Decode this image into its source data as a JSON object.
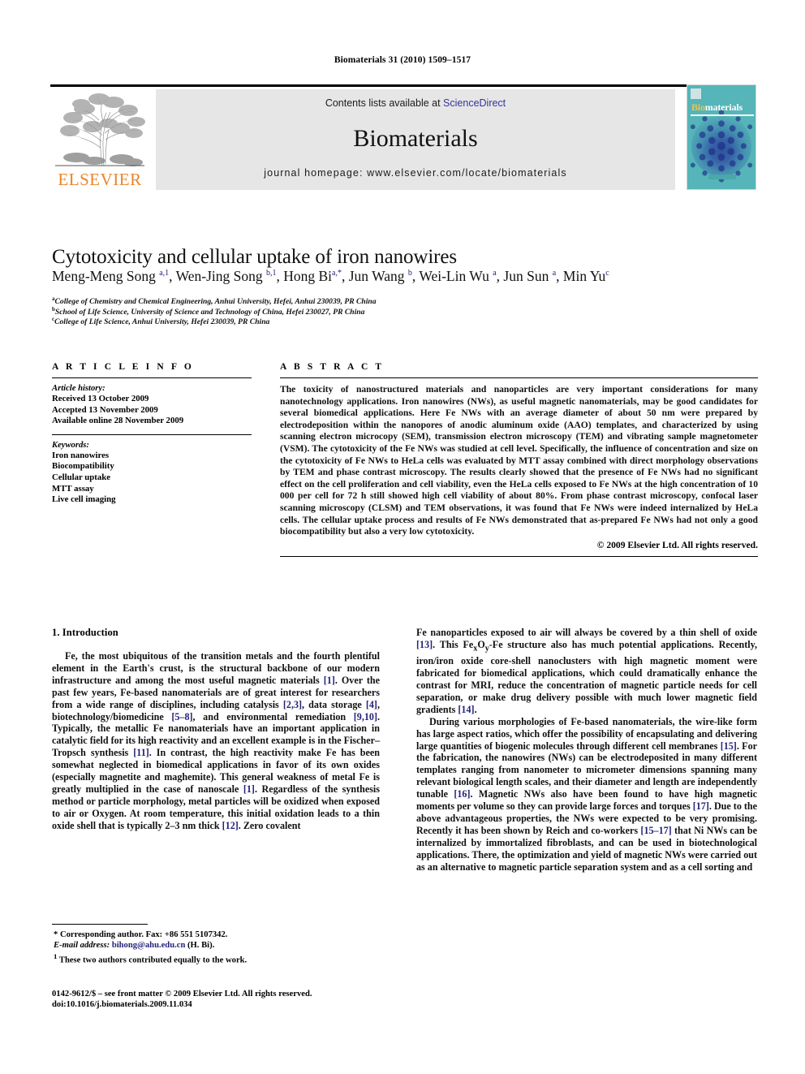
{
  "running_head": "Biomaterials 31 (2010) 1509–1517",
  "masthead": {
    "contents_prefix": "Contents lists available at ",
    "sciencedirect": "ScienceDirect",
    "journal_name": "Biomaterials",
    "homepage": "journal homepage: www.elsevier.com/locate/biomaterials",
    "publisher_wordmark": "ELSEVIER",
    "publisher_logo_icon": "elsevier-tree-logo",
    "cover": {
      "title_part1": "Bio",
      "title_part2": "materials",
      "background_color": "#55B5B8",
      "accent_color": "#F2C14B",
      "ring_color": "#2B3FA0"
    },
    "sciencedirect_color": "#33349C",
    "elsevier_orange": "#E8862B",
    "banner_bg": "#E6E6E6"
  },
  "article": {
    "title": "Cytotoxicity and cellular uptake of iron nanowires",
    "authors_html": "Meng-Meng Song <sup>a,1</sup>, Wen-Jing Song <sup>b,1</sup>, Hong Bi<sup>a,</sup><sup>*</sup>, Jun Wang <sup>b</sup>, Wei-Lin Wu <sup>a</sup>, Jun Sun <sup>a</sup>, Min Yu<sup>c</sup>",
    "affiliations": [
      {
        "marker": "a",
        "text": "College of Chemistry and Chemical Engineering, Anhui University, Hefei, Anhui 230039, PR China"
      },
      {
        "marker": "b",
        "text": "School of Life Science, University of Science and Technology of China, Hefei 230027, PR China"
      },
      {
        "marker": "c",
        "text": "College of Life Science, Anhui University, Hefei 230039, PR China"
      }
    ]
  },
  "article_info": {
    "heading": "A R T I C L E   I N F O",
    "history_label": "Article history:",
    "history": [
      "Received 13 October 2009",
      "Accepted 13 November 2009",
      "Available online 28 November 2009"
    ],
    "keywords_label": "Keywords:",
    "keywords": [
      "Iron nanowires",
      "Biocompatibility",
      "Cellular uptake",
      "MTT assay",
      "Live cell imaging"
    ]
  },
  "abstract": {
    "heading": "A B S T R A C T",
    "text": "The toxicity of nanostructured materials and nanoparticles are very important considerations for many nanotechnology applications. Iron nanowires (NWs), as useful magnetic nanomaterials, may be good candidates for several biomedical applications. Here Fe NWs with an average diameter of about 50 nm were prepared by electrodeposition within the nanopores of anodic aluminum oxide (AAO) templates, and characterized by using scanning electron microcopy (SEM), transmission electron microscopy (TEM) and vibrating sample magnetometer (VSM). The cytotoxicity of the Fe NWs was studied at cell level. Specifically, the influence of concentration and size on the cytotoxicity of Fe NWs to HeLa cells was evaluated by MTT assay combined with direct morphology observations by TEM and phase contrast microscopy. The results clearly showed that the presence of Fe NWs had no significant effect on the cell proliferation and cell viability, even the HeLa cells exposed to Fe NWs at the high concentration of 10 000 per cell for 72 h still showed high cell viability of about 80%. From phase contrast microscopy, confocal laser scanning microscopy (CLSM) and TEM observations, it was found that Fe NWs were indeed internalized by HeLa cells. The cellular uptake process and results of Fe NWs demonstrated that as-prepared Fe NWs had not only a good biocompatibility but also a very low cytotoxicity.",
    "copyright": "© 2009 Elsevier Ltd. All rights reserved."
  },
  "body": {
    "section_title": "1.  Introduction",
    "left_paragraphs": [
      "Fe, the most ubiquitous of the transition metals and the fourth plentiful element in the Earth's crust, is the structural backbone of our modern infrastructure and among the most useful magnetic materials <span class=\"ref\">[1]</span>. Over the past few years, Fe-based nanomaterials are of great interest for researchers from a wide range of disciplines, including catalysis <span class=\"ref\">[2,3]</span>, data storage <span class=\"ref\">[4]</span>, biotechnology/biomedicine <span class=\"ref\">[5–8]</span>, and environmental remediation <span class=\"ref\">[9,10]</span>. Typically, the metallic Fe nanomaterials have an important application in catalytic field for its high reactivity and an excellent example is in the Fischer–Tropsch synthesis <span class=\"ref\">[11]</span>. In contrast, the high reactivity make Fe has been somewhat neglected in biomedical applications in favor of its own oxides (especially magnetite and maghemite). This general weakness of metal Fe is greatly multiplied in the case of nanoscale <span class=\"ref\">[1]</span>. Regardless of the synthesis method or particle morphology, metal particles will be oxidized when exposed to air or Oxygen. At room temperature, this initial oxidation leads to a thin oxide shell that is typically 2–3 nm thick <span class=\"ref\">[12]</span>. Zero covalent"
    ],
    "right_paragraphs": [
      "Fe nanoparticles exposed to air will always be covered by a thin shell of oxide <span class=\"ref\">[13]</span>. This Fe<sub>x</sub>O<sub>y</sub>-Fe structure also has much potential applications. Recently, iron/iron oxide core-shell nanoclusters with high magnetic moment were fabricated for biomedical applications, which could dramatically enhance the contrast for MRI, reduce the concentration of magnetic particle needs for cell separation, or make drug delivery possible with much lower magnetic field gradients <span class=\"ref\">[14]</span>.",
      "During various morphologies of Fe-based nanomaterials, the wire-like form has large aspect ratios, which offer the possibility of encapsulating and delivering large quantities of biogenic molecules through different cell membranes <span class=\"ref\">[15]</span>. For the fabrication, the nanowires (NWs) can be electrodeposited in many different templates ranging from nanometer to micrometer dimensions spanning many relevant biological length scales, and their diameter and length are independently tunable <span class=\"ref\">[16]</span>. Magnetic NWs also have been found to have high magnetic moments per volume so they can provide large forces and torques <span class=\"ref\">[17]</span>. Due to the above advantageous properties, the NWs were expected to be very promising. Recently it has been shown by Reich and co-workers <span class=\"ref\">[15–17]</span> that Ni NWs can be internalized by immortalized fibroblasts, and can be used in biotechnological applications. There, the optimization and yield of magnetic NWs were carried out as an alternative to magnetic particle separation system and as a cell sorting and"
    ]
  },
  "footnotes": {
    "corresponding": "* Corresponding author. Fax: +86 551 5107342.",
    "email_label": "E-mail address:",
    "email": "bihong@ahu.edu.cn",
    "email_suffix": "(H. Bi).",
    "equal_contribution": "These two authors contributed equally to the work.",
    "equal_marker": "1"
  },
  "imprint": {
    "line1": "0142-9612/$ – see front matter © 2009 Elsevier Ltd. All rights reserved.",
    "line2": "doi:10.1016/j.biomaterials.2009.11.034"
  }
}
